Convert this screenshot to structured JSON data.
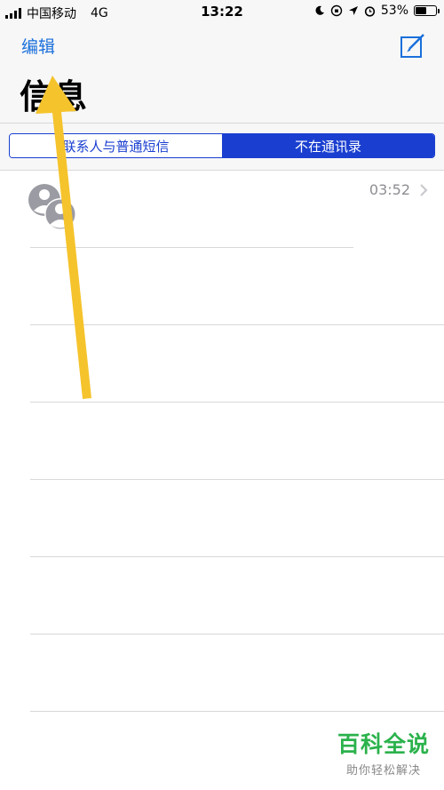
{
  "status_bar": {
    "carrier": "中国移动",
    "network": "4G",
    "time": "13:22",
    "battery_percent": "53%",
    "battery_level": 0.53
  },
  "nav": {
    "edit_label": "编辑",
    "title": "信息"
  },
  "segments": [
    {
      "label": "联系人与普通短信",
      "selected": false
    },
    {
      "label": "不在通讯录",
      "selected": true
    }
  ],
  "messages": [
    {
      "time": "03:52"
    }
  ],
  "watermark": {
    "title": "百科全说",
    "subtitle": "助你轻松解决"
  },
  "colors": {
    "accent": "#1a6fdb",
    "segment": "#1a3fd0",
    "arrow": "#f5c32c",
    "watermark": "#2bb24c"
  }
}
